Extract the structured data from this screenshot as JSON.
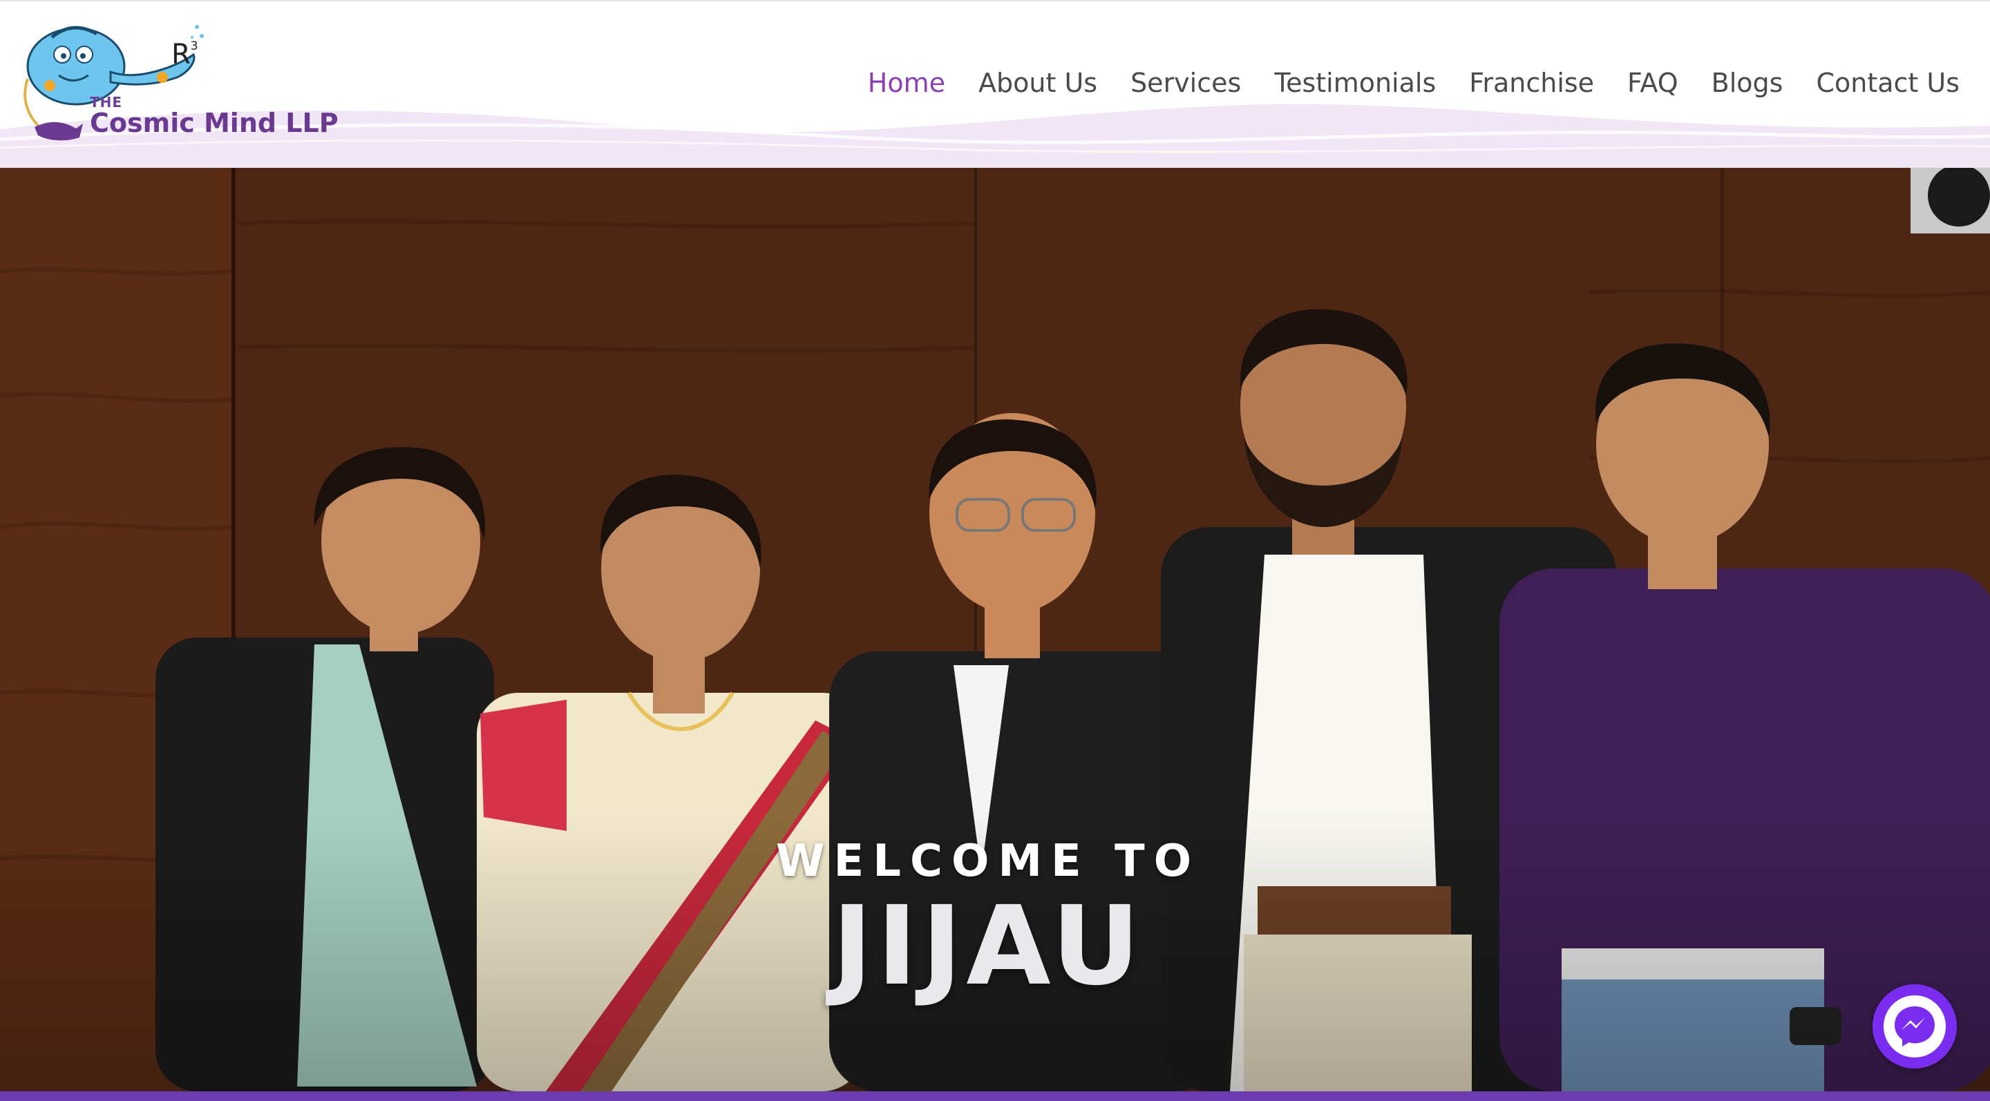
{
  "logo": {
    "the_text": "THE",
    "name": "Cosmic Mind LLP",
    "mark": "R",
    "mark_sup": "3",
    "icon": "genie-lamp-icon"
  },
  "nav": {
    "items": [
      {
        "label": "Home",
        "active": true
      },
      {
        "label": "About Us",
        "active": false
      },
      {
        "label": "Services",
        "active": false
      },
      {
        "label": "Testimonials",
        "active": false
      },
      {
        "label": "Franchise",
        "active": false
      },
      {
        "label": "FAQ",
        "active": false
      },
      {
        "label": "Blogs",
        "active": false
      },
      {
        "label": "Contact Us",
        "active": false
      }
    ]
  },
  "hero": {
    "welcome": "WELCOME TO",
    "title": "JIJAU",
    "photo": "team-photo"
  },
  "chat": {
    "icon": "messenger-icon"
  },
  "colors": {
    "accent": "#8b3fb5",
    "brand_purple": "#6a3a92",
    "messenger": "#7a2df0",
    "wave": "#f1e6f5",
    "bottom_bar": "#6c3bb0"
  }
}
